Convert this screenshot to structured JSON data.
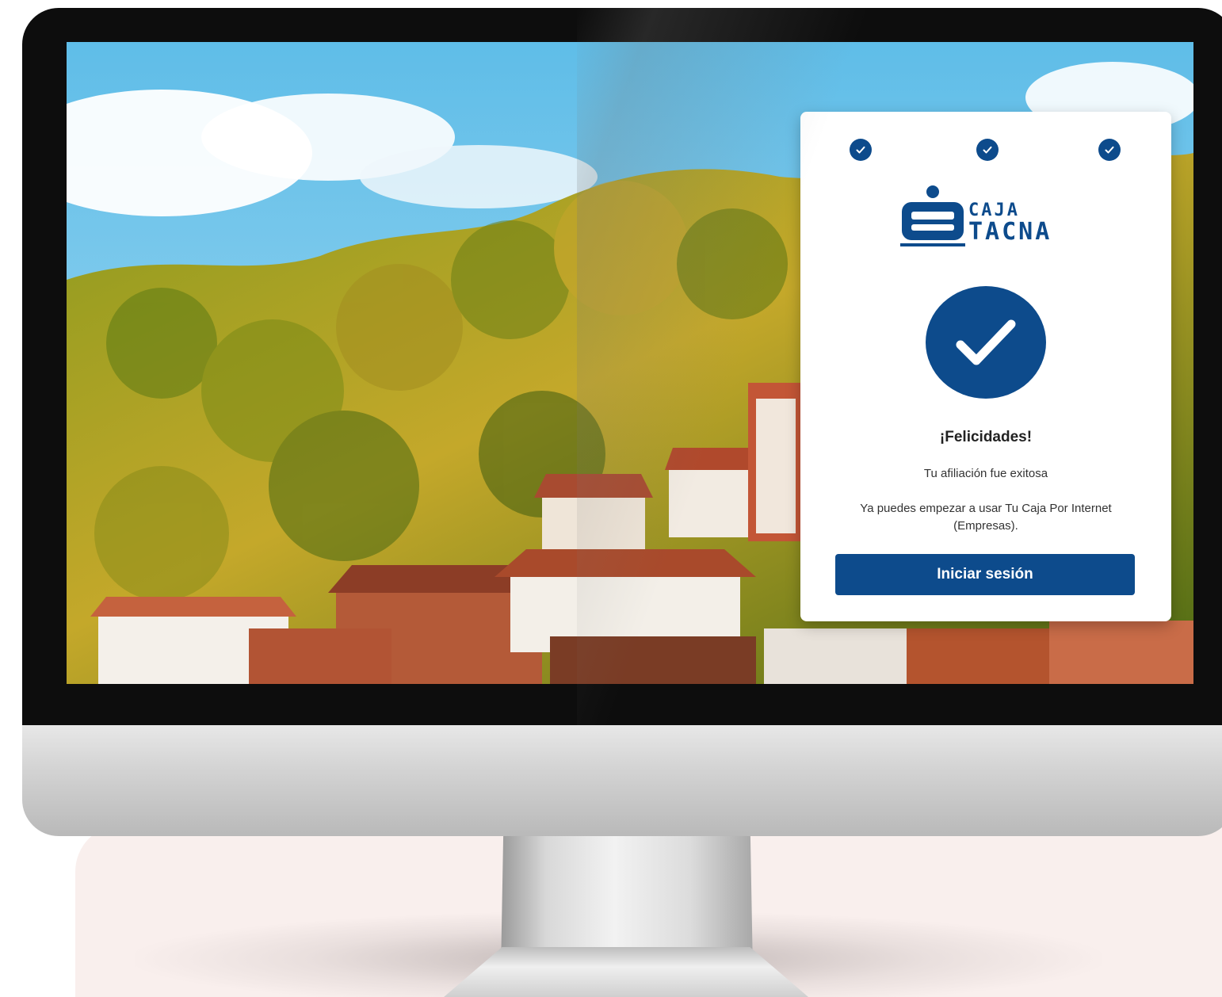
{
  "stepper": {
    "steps": [
      {
        "state": "completed",
        "icon": "check-icon"
      },
      {
        "state": "completed",
        "icon": "check-icon"
      },
      {
        "state": "completed",
        "icon": "check-icon"
      }
    ]
  },
  "logo": {
    "line1": "CAJA",
    "line2": "TACNA"
  },
  "success": {
    "icon": "check-icon",
    "title": "¡Felicidades!",
    "subtitle": "Tu afiliación fue exitosa",
    "message": "Ya puedes empezar a usar Tu Caja Por Internet (Empresas).",
    "button_label": "Iniciar sesión"
  },
  "colors": {
    "brand": "#0d4b8c",
    "card": "#ffffff",
    "backdrop": "#f9efed"
  }
}
